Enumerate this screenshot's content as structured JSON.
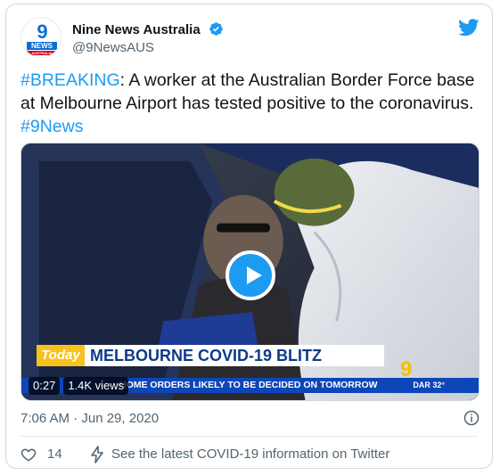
{
  "author": {
    "name": "Nine News Australia",
    "handle": "@9NewsAUS",
    "avatar_text": {
      "top": "9",
      "middle": "NEWS",
      "bottom": "AUSTRALIA"
    },
    "verified": true
  },
  "tweet": {
    "hashtag_breaking": "#BREAKING",
    "body": ": A worker at the Australian Border Force base at Melbourne Airport has tested positive to the coronavirus. ",
    "hashtag_9news": "#9News"
  },
  "video": {
    "duration": "0:27",
    "views": "1.4K views",
    "overlay": {
      "show_tag": "Today",
      "headline": "MELBOURNE COVID-19 BLITZ",
      "ticker": "HOME ORDERS LIKELY TO BE DECIDED ON TOMORROW",
      "weather": "DAR 32°",
      "channel_logo": "9"
    }
  },
  "meta": {
    "timestamp": "7:06 AM · Jun 29, 2020"
  },
  "actions": {
    "likes_count": "14",
    "covid_info_label": "See the latest COVID-19 information on Twitter"
  },
  "colors": {
    "accent": "#1d9bf0",
    "text_primary": "#0f1419",
    "text_secondary": "#536471",
    "border": "#cfd9de"
  },
  "icons": [
    "verified-badge-icon",
    "twitter-bird-icon",
    "play-icon",
    "info-icon",
    "heart-icon",
    "lightning-icon"
  ]
}
